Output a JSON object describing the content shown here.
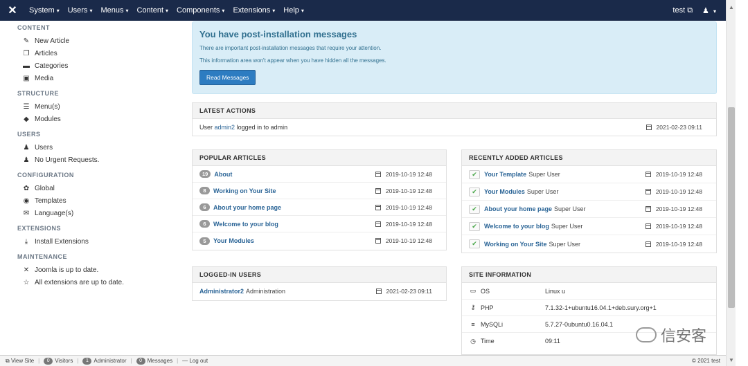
{
  "navbar": {
    "logo_glyph": "✕",
    "menus": [
      {
        "label": "System"
      },
      {
        "label": "Users"
      },
      {
        "label": "Menus"
      },
      {
        "label": "Content"
      },
      {
        "label": "Components"
      },
      {
        "label": "Extensions"
      },
      {
        "label": "Help"
      }
    ],
    "site_link": "test",
    "user_icon": "user-icon"
  },
  "sidebar": {
    "sections": [
      {
        "title": "CONTENT",
        "items": [
          {
            "label": "New Article",
            "icon": "✎",
            "icon_name": "pencil-icon"
          },
          {
            "label": "Articles",
            "icon": "❐",
            "icon_name": "copy-icon"
          },
          {
            "label": "Categories",
            "icon": "▬",
            "icon_name": "folder-icon"
          },
          {
            "label": "Media",
            "icon": "▣",
            "icon_name": "image-icon"
          }
        ]
      },
      {
        "title": "STRUCTURE",
        "items": [
          {
            "label": "Menu(s)",
            "icon": "☰",
            "icon_name": "list-icon"
          },
          {
            "label": "Modules",
            "icon": "◆",
            "icon_name": "cube-icon"
          }
        ]
      },
      {
        "title": "USERS",
        "items": [
          {
            "label": "Users",
            "icon": "♟",
            "icon_name": "users-icon"
          },
          {
            "label": "No Urgent Requests.",
            "icon": "♟",
            "icon_name": "users-icon"
          }
        ]
      },
      {
        "title": "CONFIGURATION",
        "items": [
          {
            "label": "Global",
            "icon": "✿",
            "icon_name": "cog-icon"
          },
          {
            "label": "Templates",
            "icon": "◉",
            "icon_name": "eye-icon"
          },
          {
            "label": "Language(s)",
            "icon": "✉",
            "icon_name": "comments-icon"
          }
        ]
      },
      {
        "title": "EXTENSIONS",
        "items": [
          {
            "label": "Install Extensions",
            "icon": "⤓",
            "icon_name": "download-icon"
          }
        ]
      },
      {
        "title": "MAINTENANCE",
        "items": [
          {
            "label": "Joomla is up to date.",
            "icon": "✕",
            "icon_name": "joomla-icon"
          },
          {
            "label": "All extensions are up to date.",
            "icon": "☆",
            "icon_name": "star-icon"
          }
        ]
      }
    ]
  },
  "alert": {
    "title": "You have post-installation messages",
    "line1": "There are important post-installation messages that require your attention.",
    "line2": "This information area won't appear when you have hidden all the messages.",
    "button": "Read Messages"
  },
  "latest_actions": {
    "title": "LATEST ACTIONS",
    "prefix": "User",
    "user": "admin2",
    "suffix": "logged in to admin",
    "date": "2021-02-23 09:11"
  },
  "popular_articles": {
    "title": "POPULAR ARTICLES",
    "rows": [
      {
        "hits": "19",
        "title": "About",
        "date": "2019-10-19 12:48"
      },
      {
        "hits": "8",
        "title": "Working on Your Site",
        "date": "2019-10-19 12:48"
      },
      {
        "hits": "6",
        "title": "About your home page",
        "date": "2019-10-19 12:48"
      },
      {
        "hits": "6",
        "title": "Welcome to your blog",
        "date": "2019-10-19 12:48"
      },
      {
        "hits": "5",
        "title": "Your Modules",
        "date": "2019-10-19 12:48"
      }
    ]
  },
  "recent_articles": {
    "title": "RECENTLY ADDED ARTICLES",
    "rows": [
      {
        "title": "Your Template",
        "author": "Super User",
        "date": "2019-10-19 12:48"
      },
      {
        "title": "Your Modules",
        "author": "Super User",
        "date": "2019-10-19 12:48"
      },
      {
        "title": "About your home page",
        "author": "Super User",
        "date": "2019-10-19 12:48"
      },
      {
        "title": "Welcome to your blog",
        "author": "Super User",
        "date": "2019-10-19 12:48"
      },
      {
        "title": "Working on Your Site",
        "author": "Super User",
        "date": "2019-10-19 12:48"
      }
    ]
  },
  "logged_in": {
    "title": "LOGGED-IN USERS",
    "user": "Administrator2",
    "location": "Administration",
    "date": "2021-02-23 09:11"
  },
  "site_info": {
    "title": "SITE INFORMATION",
    "rows": [
      {
        "key": "OS",
        "value": "Linux u",
        "icon": "▭",
        "icon_name": "monitor-icon"
      },
      {
        "key": "PHP",
        "value": "7.1.32-1+ubuntu16.04.1+deb.sury.org+1",
        "icon": "⚷",
        "icon_name": "key-icon"
      },
      {
        "key": "MySQLi",
        "value": "5.7.27-0ubuntu0.16.04.1",
        "icon": "≡",
        "icon_name": "database-icon"
      },
      {
        "key": "Time",
        "value": "09:11",
        "icon": "◷",
        "icon_name": "clock-icon"
      }
    ]
  },
  "footer": {
    "view_site": "View Site",
    "visitors_count": "0",
    "visitors": "Visitors",
    "admin_count": "1",
    "admin": "Administrator",
    "messages_count": "0",
    "messages": "Messages",
    "logout": "Log out",
    "copyright": "© 2021 test"
  },
  "watermark": "信安客",
  "colors": {
    "navbar": "#1a2a4a",
    "link": "#2a6496",
    "alert_bg": "#d9edf7",
    "button": "#2d7cc1"
  }
}
